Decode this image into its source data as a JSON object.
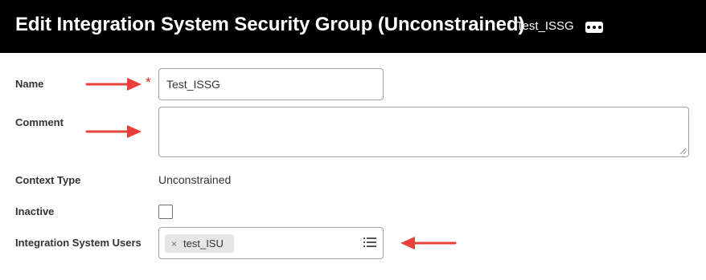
{
  "header": {
    "title": "Edit Integration System Security Group (Unconstrained)",
    "subtitle": "Test_ISSG",
    "more_icon": "more-options-icon"
  },
  "form": {
    "name": {
      "label": "Name",
      "value": "Test_ISSG",
      "required_marker": "*"
    },
    "comment": {
      "label": "Comment",
      "value": ""
    },
    "context_type": {
      "label": "Context Type",
      "value": "Unconstrained"
    },
    "inactive": {
      "label": "Inactive",
      "checked": false
    },
    "integration_system_users": {
      "label": "Integration System Users",
      "selected": [
        {
          "label": "test_ISU",
          "remove_icon": "×"
        }
      ],
      "prompt_icon": "list-icon"
    }
  },
  "annotations": {
    "arrow_color": "#e8403a"
  },
  "colors": {
    "header_bg": "#000000",
    "required": "#d52b1e"
  }
}
